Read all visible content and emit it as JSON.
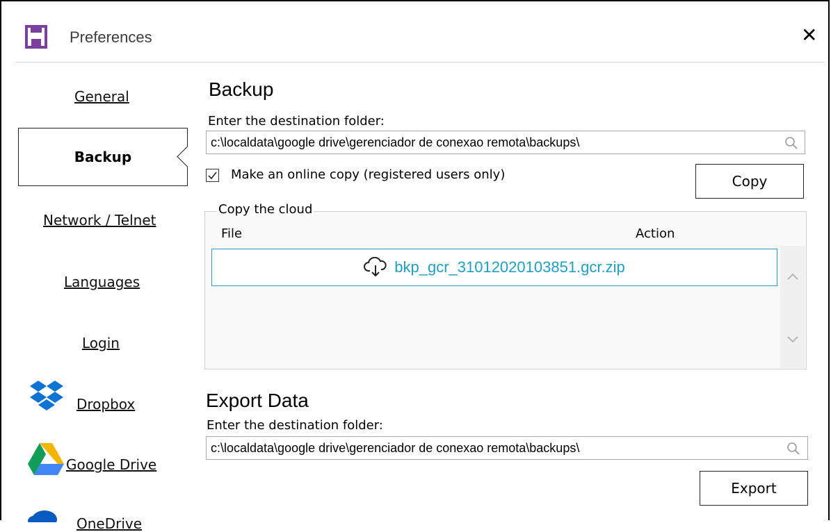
{
  "window": {
    "title": "Preferences",
    "close_glyph": "✕",
    "app_icon": "floppy-disk-icon"
  },
  "sidebar": {
    "items": [
      {
        "label": "General"
      },
      {
        "label": "Backup",
        "active": true
      },
      {
        "label": "Network / Telnet"
      },
      {
        "label": "Languages"
      },
      {
        "label": "Login"
      },
      {
        "label": "Dropbox",
        "icon": "dropbox-icon"
      },
      {
        "label": "Google Drive",
        "icon": "google-drive-icon"
      },
      {
        "label": "OneDrive",
        "icon": "onedrive-icon"
      }
    ]
  },
  "backup": {
    "heading": "Backup",
    "dest_label": "Enter the destination folder:",
    "dest_value": "c:\\localdata\\google drive\\gerenciador de conexao remota\\backups\\",
    "online_copy_label": "Make an online copy (registered users only)",
    "online_copy_checked": true,
    "copy_button": "Copy",
    "cloud_group": {
      "legend": "Copy the cloud",
      "columns": [
        "File",
        "Action"
      ],
      "files": [
        {
          "name": "bkp_gcr_31012020103851.gcr.zip",
          "icon": "cloud-download-icon"
        }
      ]
    }
  },
  "export": {
    "heading": "Export Data",
    "dest_label": "Enter the destination folder:",
    "dest_value": "c:\\localdata\\google drive\\gerenciador de conexao remota\\backups\\",
    "export_button": "Export"
  },
  "colors": {
    "accent": "#1e9fc6",
    "file_border": "#2a9dbd",
    "icon_purple": "#7b3fa0"
  }
}
